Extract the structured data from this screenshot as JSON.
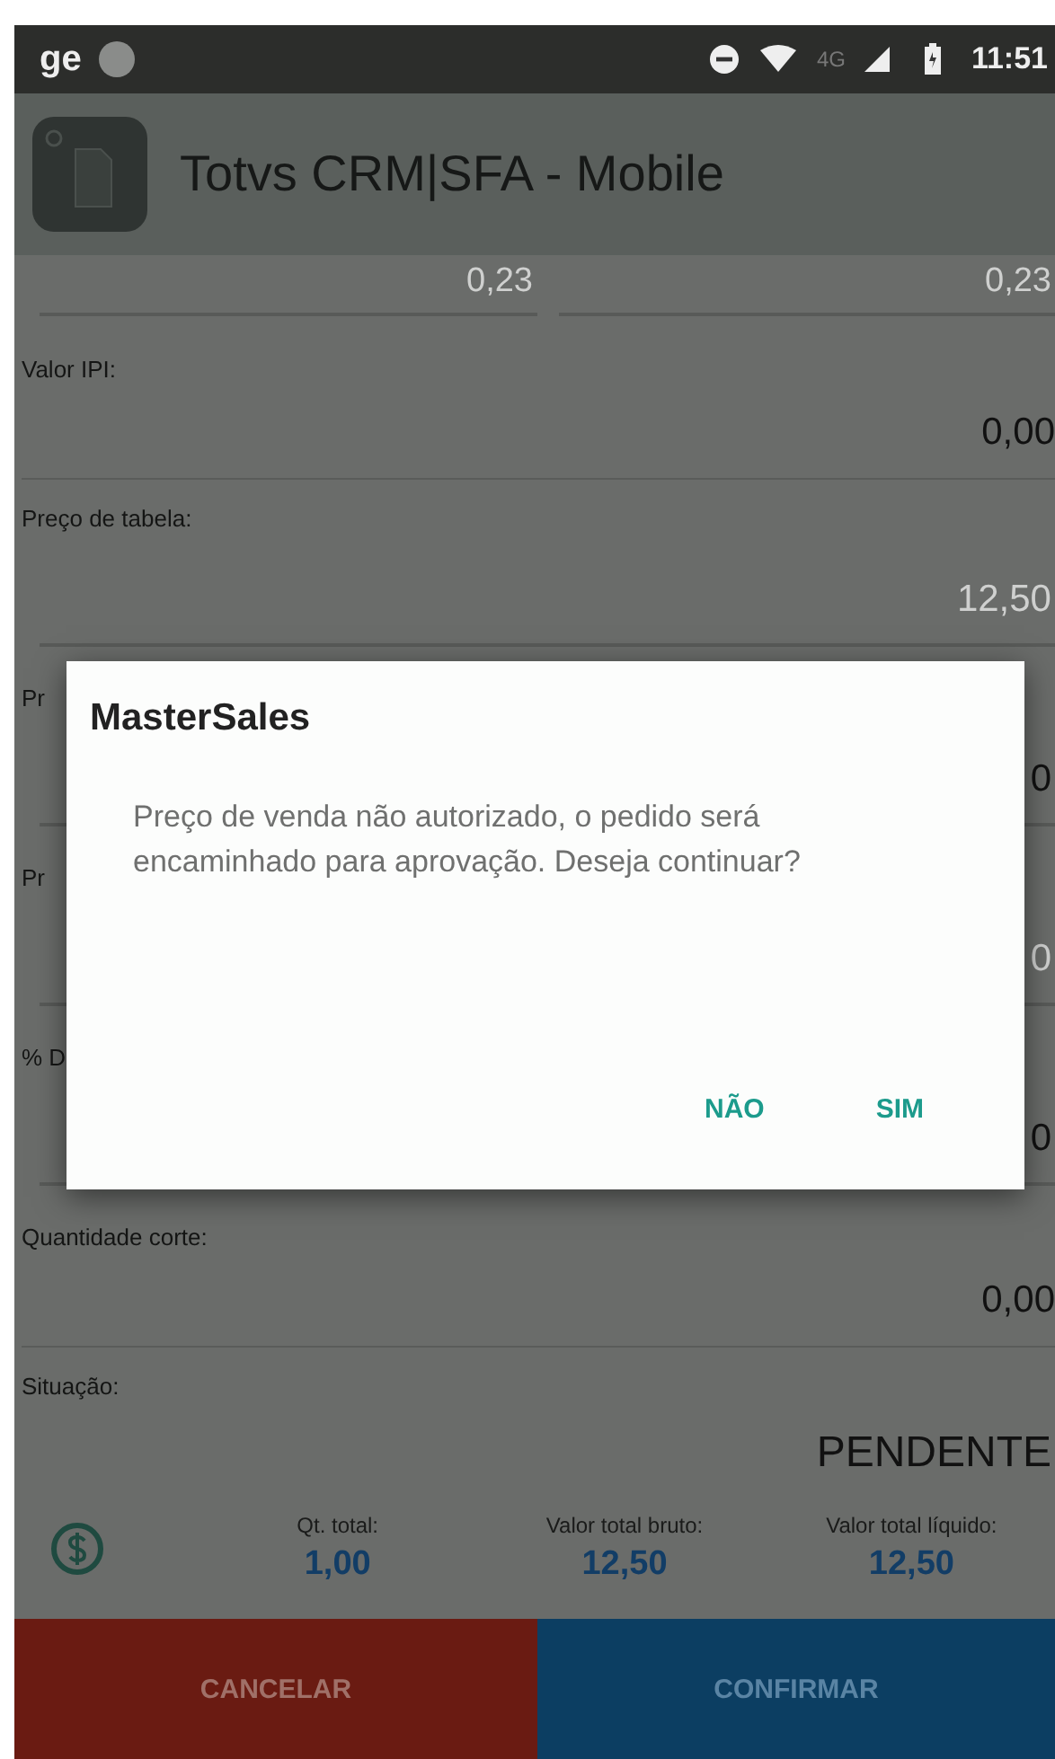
{
  "status_bar": {
    "carrier": "ge",
    "network": "4G",
    "time": "11:51"
  },
  "app_bar": {
    "title": "Totvs CRM|SFA - Mobile"
  },
  "top_row": [
    {
      "value": "0,23",
      "disabled": true
    },
    {
      "value": "0,23",
      "disabled": true
    }
  ],
  "fields": [
    {
      "label": "Valor IPI:",
      "value": "0,00",
      "kind": "display",
      "disabled": false
    },
    {
      "label": "Preço de tabela:",
      "value": "12,50",
      "kind": "input",
      "disabled": true
    },
    {
      "label": "Pr",
      "value": "0",
      "kind": "input",
      "disabled": false
    },
    {
      "label": "Pr",
      "value": "0",
      "kind": "input",
      "disabled": true
    },
    {
      "label": "% D",
      "value": "0",
      "kind": "input",
      "disabled": false
    },
    {
      "label": "Quantidade corte:",
      "value": "0,00",
      "kind": "display",
      "disabled": false
    },
    {
      "label": "Situação:",
      "value": "PENDENTE",
      "kind": "status",
      "disabled": false
    }
  ],
  "totals": [
    {
      "label": "Qt. total:",
      "value": "1,00"
    },
    {
      "label": "Valor total bruto:",
      "value": "12,50"
    },
    {
      "label": "Valor total líquido:",
      "value": "12,50"
    }
  ],
  "buttons": [
    {
      "label": "CANCELAR",
      "kind": "cancel"
    },
    {
      "label": "CONFIRMAR",
      "kind": "confirm"
    }
  ],
  "dialog": {
    "title": "MasterSales",
    "message": "Preço de venda não autorizado, o pedido será encaminhado para aprovação. Deseja continuar?",
    "actions": [
      "NÃO",
      "SIM"
    ]
  }
}
